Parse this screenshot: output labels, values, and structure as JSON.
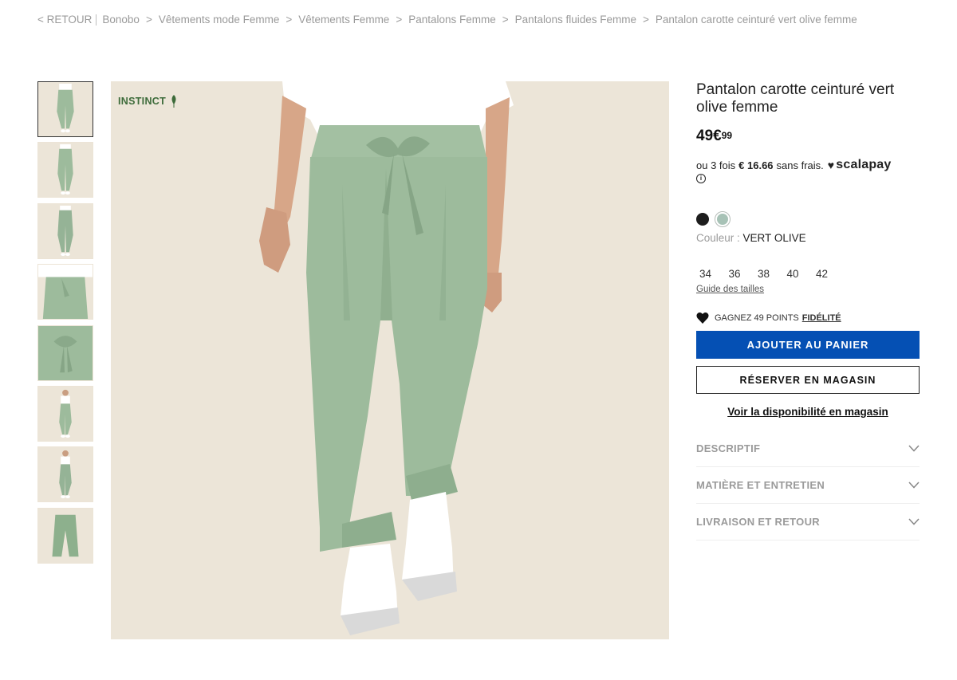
{
  "breadcrumb": {
    "back": "< RETOUR",
    "items": [
      "Bonobo",
      "Vêtements mode Femme",
      "Vêtements Femme",
      "Pantalons Femme",
      "Pantalons fluides Femme",
      "Pantalon carotte ceinturé vert olive femme"
    ],
    "separator": ">"
  },
  "gallery": {
    "thumbnail_count": 8,
    "active_thumbnail": 1,
    "badge": "INSTINCT"
  },
  "product": {
    "title": "Pantalon carotte ceinturé vert olive femme",
    "price_main": "49€",
    "price_cents": "99",
    "installment_prefix": "ou 3 fois",
    "installment_amount": "€ 16.66",
    "installment_suffix": "sans frais.",
    "payment_provider": "scalapay",
    "colors": [
      {
        "name": "black",
        "hex": "#1d1d1d"
      },
      {
        "name": "vert olive",
        "hex": "#a7c2b6",
        "selected": true
      }
    ],
    "color_label": "Couleur :",
    "color_value": "VERT OLIVE",
    "sizes": [
      "34",
      "36",
      "38",
      "40",
      "42"
    ],
    "size_guide": "Guide des tailles",
    "loyalty_text": "GAGNEZ 49 POINTS",
    "loyalty_link": "FIDÉLITÉ",
    "add_to_cart": "AJOUTER AU PANIER",
    "reserve_in_store": "RÉSERVER EN MAGASIN",
    "availability_link": "Voir la disponibilité en magasin",
    "accordion": [
      "DESCRIPTIF",
      "MATIÈRE ET ENTRETIEN",
      "LIVRAISON ET RETOUR"
    ]
  },
  "colors": {
    "primary_button": "#0550b4",
    "muted_text": "#9a9a9a",
    "product_green": "#9dbb9c",
    "background": "#ece5d8"
  }
}
